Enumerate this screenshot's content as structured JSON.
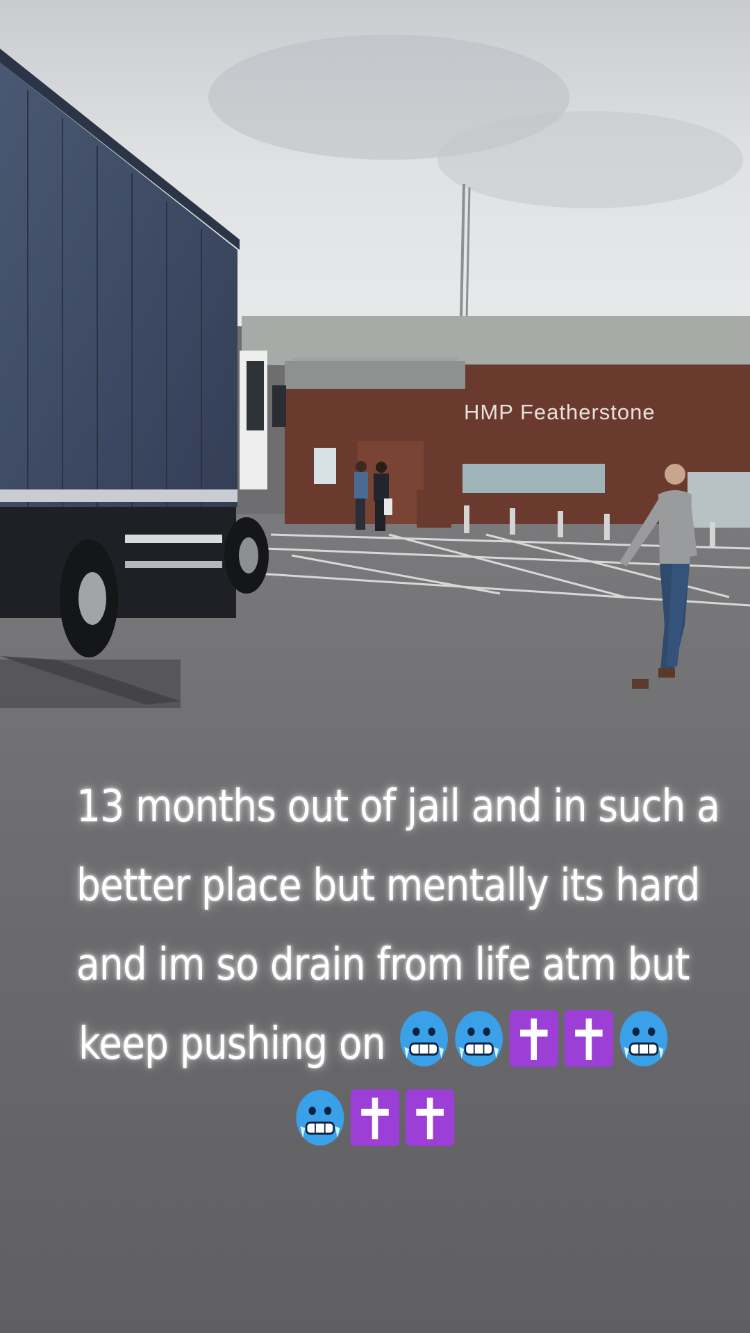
{
  "scene": {
    "sign_text": "HMP Featherstone",
    "colors": {
      "sky": "#d9dbde",
      "brick": "#6b3a2e",
      "roof": "#a7aba8",
      "tarp": "#3d4a63",
      "asphalt": "#6e6e70"
    }
  },
  "caption": {
    "lines": [
      "13 months out of jail and in such a",
      "better place  but mentally its hard",
      "and im so drain from life atm but",
      "keep pushing on"
    ],
    "emoji_line_1": [
      "cold-face-emoji",
      "cold-face-emoji",
      "latin-cross-emoji",
      "latin-cross-emoji",
      "cold-face-emoji"
    ],
    "emoji_line_2": [
      "cold-face-emoji",
      "latin-cross-emoji",
      "latin-cross-emoji"
    ],
    "emoji_colors": {
      "cold_face": "#3aa0e8",
      "cross_box": "#9b3fd6"
    }
  }
}
